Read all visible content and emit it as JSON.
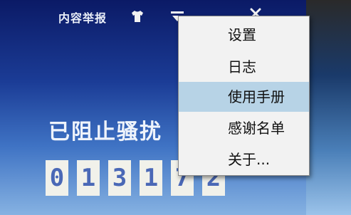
{
  "topbar": {
    "report_label": "内容举报",
    "shirt_icon": "shirt-icon",
    "menu_icon": "dropdown-menu-icon",
    "close_icon": "close-icon"
  },
  "main": {
    "blocked_label": "已阻止骚扰",
    "blocked_count_digits": [
      "0",
      "1",
      "3",
      "1",
      "7",
      "2"
    ]
  },
  "menu": {
    "items": [
      {
        "label": "设置"
      },
      {
        "label": "日志"
      },
      {
        "label": "使用手册",
        "highlighted": true
      },
      {
        "label": "感谢名单"
      },
      {
        "label": "关于..."
      }
    ]
  },
  "colors": {
    "background_top": "#0b1a66",
    "background_bottom": "#86b2e2",
    "menu_highlight": "#b7d3e6",
    "digit_text": "#4a68b6",
    "digit_background": "#f1f1ea"
  }
}
